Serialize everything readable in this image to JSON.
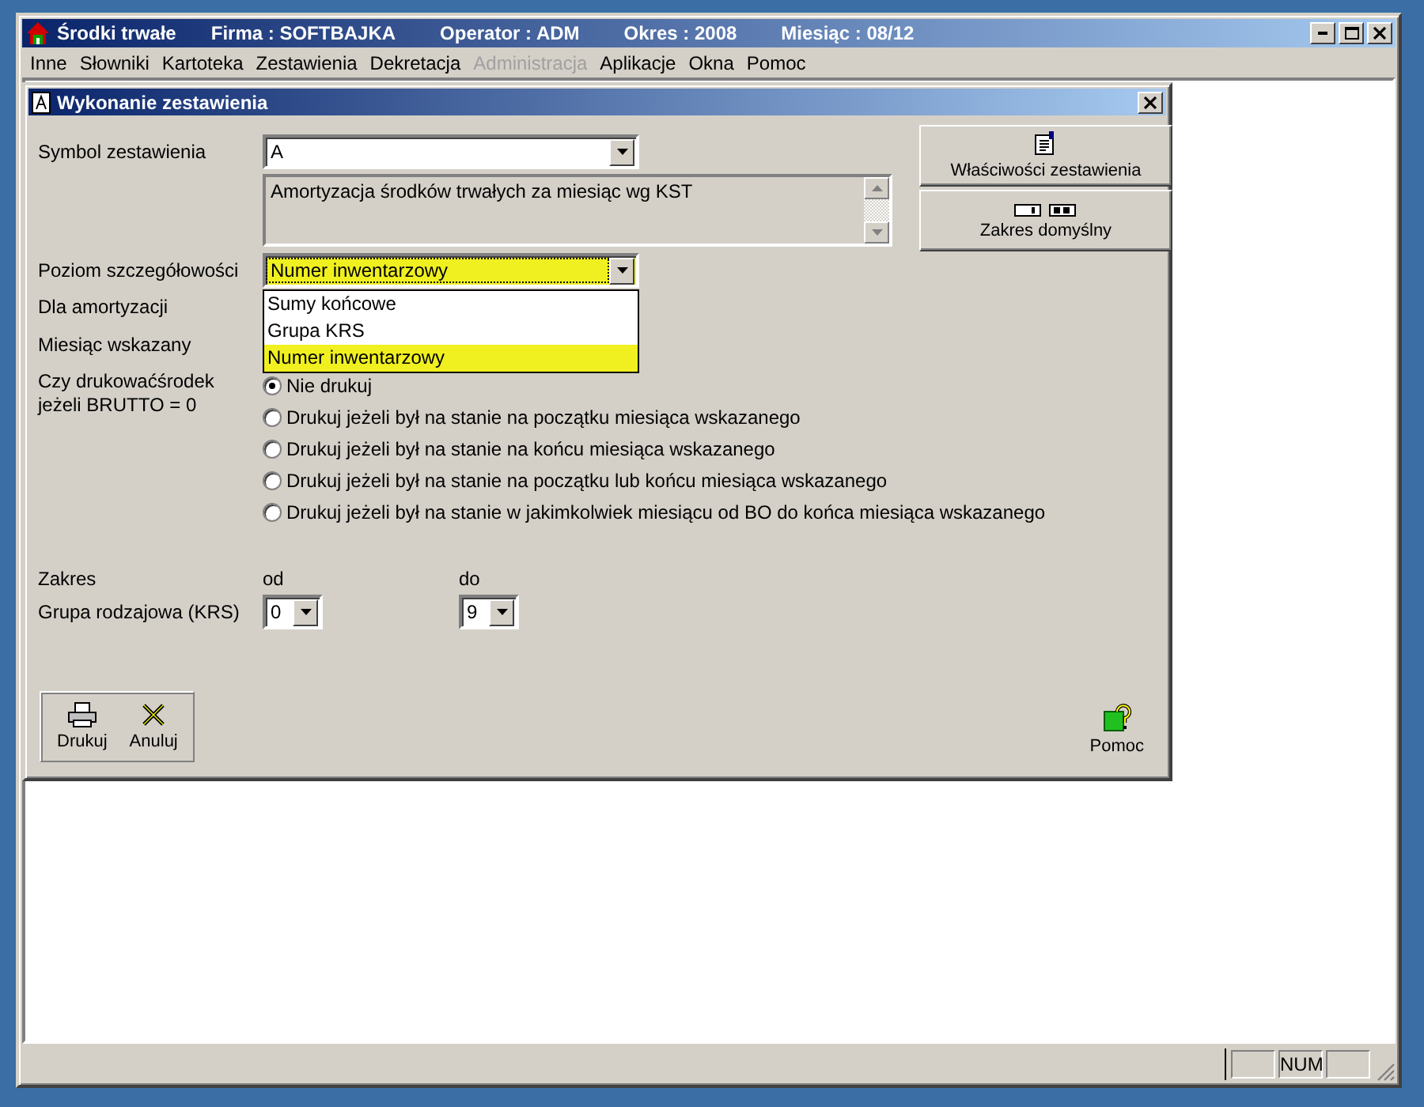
{
  "window": {
    "title": "Środki trwałe",
    "info": [
      "Firma : SOFTBAJKA",
      "Operator : ADM",
      "Okres : 2008",
      "Miesiąc : 08/12"
    ]
  },
  "menu": [
    {
      "label": "Inne",
      "disabled": false
    },
    {
      "label": "Słowniki",
      "disabled": false
    },
    {
      "label": "Kartoteka",
      "disabled": false
    },
    {
      "label": "Zestawienia",
      "disabled": false
    },
    {
      "label": "Dekretacja",
      "disabled": false
    },
    {
      "label": "Administracja",
      "disabled": true
    },
    {
      "label": "Aplikacje",
      "disabled": false
    },
    {
      "label": "Okna",
      "disabled": false
    },
    {
      "label": "Pomoc",
      "disabled": false
    }
  ],
  "dialog": {
    "title": "Wykonanie zestawienia",
    "symbol": {
      "label": "Symbol zestawienia",
      "value": "A",
      "description": "Amortyzacja środków trwałych za miesiąc wg KST"
    },
    "level": {
      "label": "Poziom szczegółowości",
      "value": "Numer inwentarzowy",
      "focused": true,
      "options": [
        {
          "label": "Sumy końcowe",
          "selected": false
        },
        {
          "label": "Grupa KRS",
          "selected": false
        },
        {
          "label": "Numer inwentarzowy",
          "selected": true
        }
      ]
    },
    "labels": [
      "Dla amortyzacji",
      "Miesiąc wskazany"
    ],
    "print_zero": {
      "label": "Czy drukowaćśrodek\njeżeli BRUTTO = 0",
      "options": [
        {
          "label": "Nie drukuj",
          "selected": true
        },
        {
          "label": "Drukuj jeżeli był na stanie na początku miesiąca wskazanego",
          "selected": false
        },
        {
          "label": "Drukuj jeżeli był na stanie na końcu miesiąca wskazanego",
          "selected": false
        },
        {
          "label": "Drukuj jeżeli był na stanie na początku lub końcu miesiąca wskazanego",
          "selected": false
        },
        {
          "label": "Drukuj jeżeli był na stanie w jakimkolwiek miesiącu od BO do końca miesiąca wskazanego",
          "selected": false
        }
      ]
    },
    "range": {
      "label": "Zakres",
      "from_label": "od",
      "to_label": "do",
      "group_label": "Grupa rodzajowa (KRS)",
      "from": "0",
      "to": "9"
    },
    "side_buttons": [
      {
        "label": "Właściwości zestawienia",
        "kind": "properties"
      },
      {
        "label": "Zakres domyślny",
        "kind": "range"
      }
    ],
    "actions": [
      {
        "label": "Drukuj",
        "kind": "print"
      },
      {
        "label": "Anuluj",
        "kind": "cancel"
      }
    ],
    "help": "Pomoc"
  },
  "status_bar": [
    {
      "kind": "blank"
    },
    {
      "kind": "text",
      "text": "NUM"
    },
    {
      "kind": "blank"
    }
  ]
}
